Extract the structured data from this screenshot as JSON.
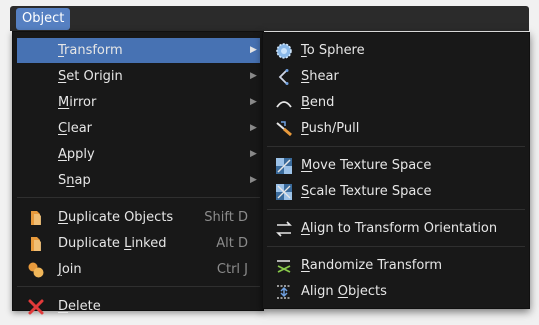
{
  "header": {
    "menu_label": "Object"
  },
  "menu": {
    "items": [
      {
        "label": "Transform",
        "u": "T",
        "rest": "ransform"
      },
      {
        "label": "Set Origin",
        "u": "S",
        "rest": "et Origin"
      },
      {
        "label": "Mirror",
        "u": "M",
        "rest": "irror"
      },
      {
        "label": "Clear",
        "u": "C",
        "rest": "lear"
      },
      {
        "label": "Apply",
        "u": "A",
        "rest": "pply"
      },
      {
        "label": "Snap",
        "pre": "S",
        "u": "n",
        "rest": "ap"
      },
      {
        "label": "Duplicate Objects",
        "u": "D",
        "rest": "uplicate Objects",
        "shortcut": "Shift D"
      },
      {
        "label": "Duplicate Linked",
        "pre": "Duplicate ",
        "u": "L",
        "rest": "inked",
        "shortcut": "Alt D"
      },
      {
        "label": "Join",
        "u": "J",
        "rest": "oin",
        "shortcut": "Ctrl J"
      },
      {
        "label": "Delete",
        "u": "D",
        "rest": "elete"
      }
    ]
  },
  "submenu": {
    "items": [
      {
        "label": "To Sphere",
        "u": "T",
        "rest": "o Sphere",
        "icon": "to-sphere-icon"
      },
      {
        "label": "Shear",
        "u": "S",
        "rest": "hear",
        "icon": "shear-icon"
      },
      {
        "label": "Bend",
        "u": "B",
        "rest": "end",
        "icon": "bend-icon"
      },
      {
        "label": "Push/Pull",
        "u": "P",
        "rest": "ush/Pull",
        "icon": "push-pull-icon"
      },
      {
        "label": "Move Texture Space",
        "u": "M",
        "rest": "ove Texture Space",
        "icon": "move-texture-space-icon"
      },
      {
        "label": "Scale Texture Space",
        "u": "S",
        "rest": "cale Texture Space",
        "icon": "scale-texture-space-icon"
      },
      {
        "label": "Align to Transform Orientation",
        "u": "A",
        "rest": "lign to Transform Orientation",
        "icon": "align-orientation-icon"
      },
      {
        "label": "Randomize Transform",
        "u": "R",
        "rest": "andomize Transform",
        "icon": "randomize-transform-icon"
      },
      {
        "label": "Align Objects",
        "pre": "Align ",
        "u": "O",
        "rest": "bjects",
        "icon": "align-objects-icon"
      }
    ]
  },
  "colors": {
    "highlight": "#4772b3",
    "menu_bg": "#181818",
    "header_active": "#5680c2"
  }
}
